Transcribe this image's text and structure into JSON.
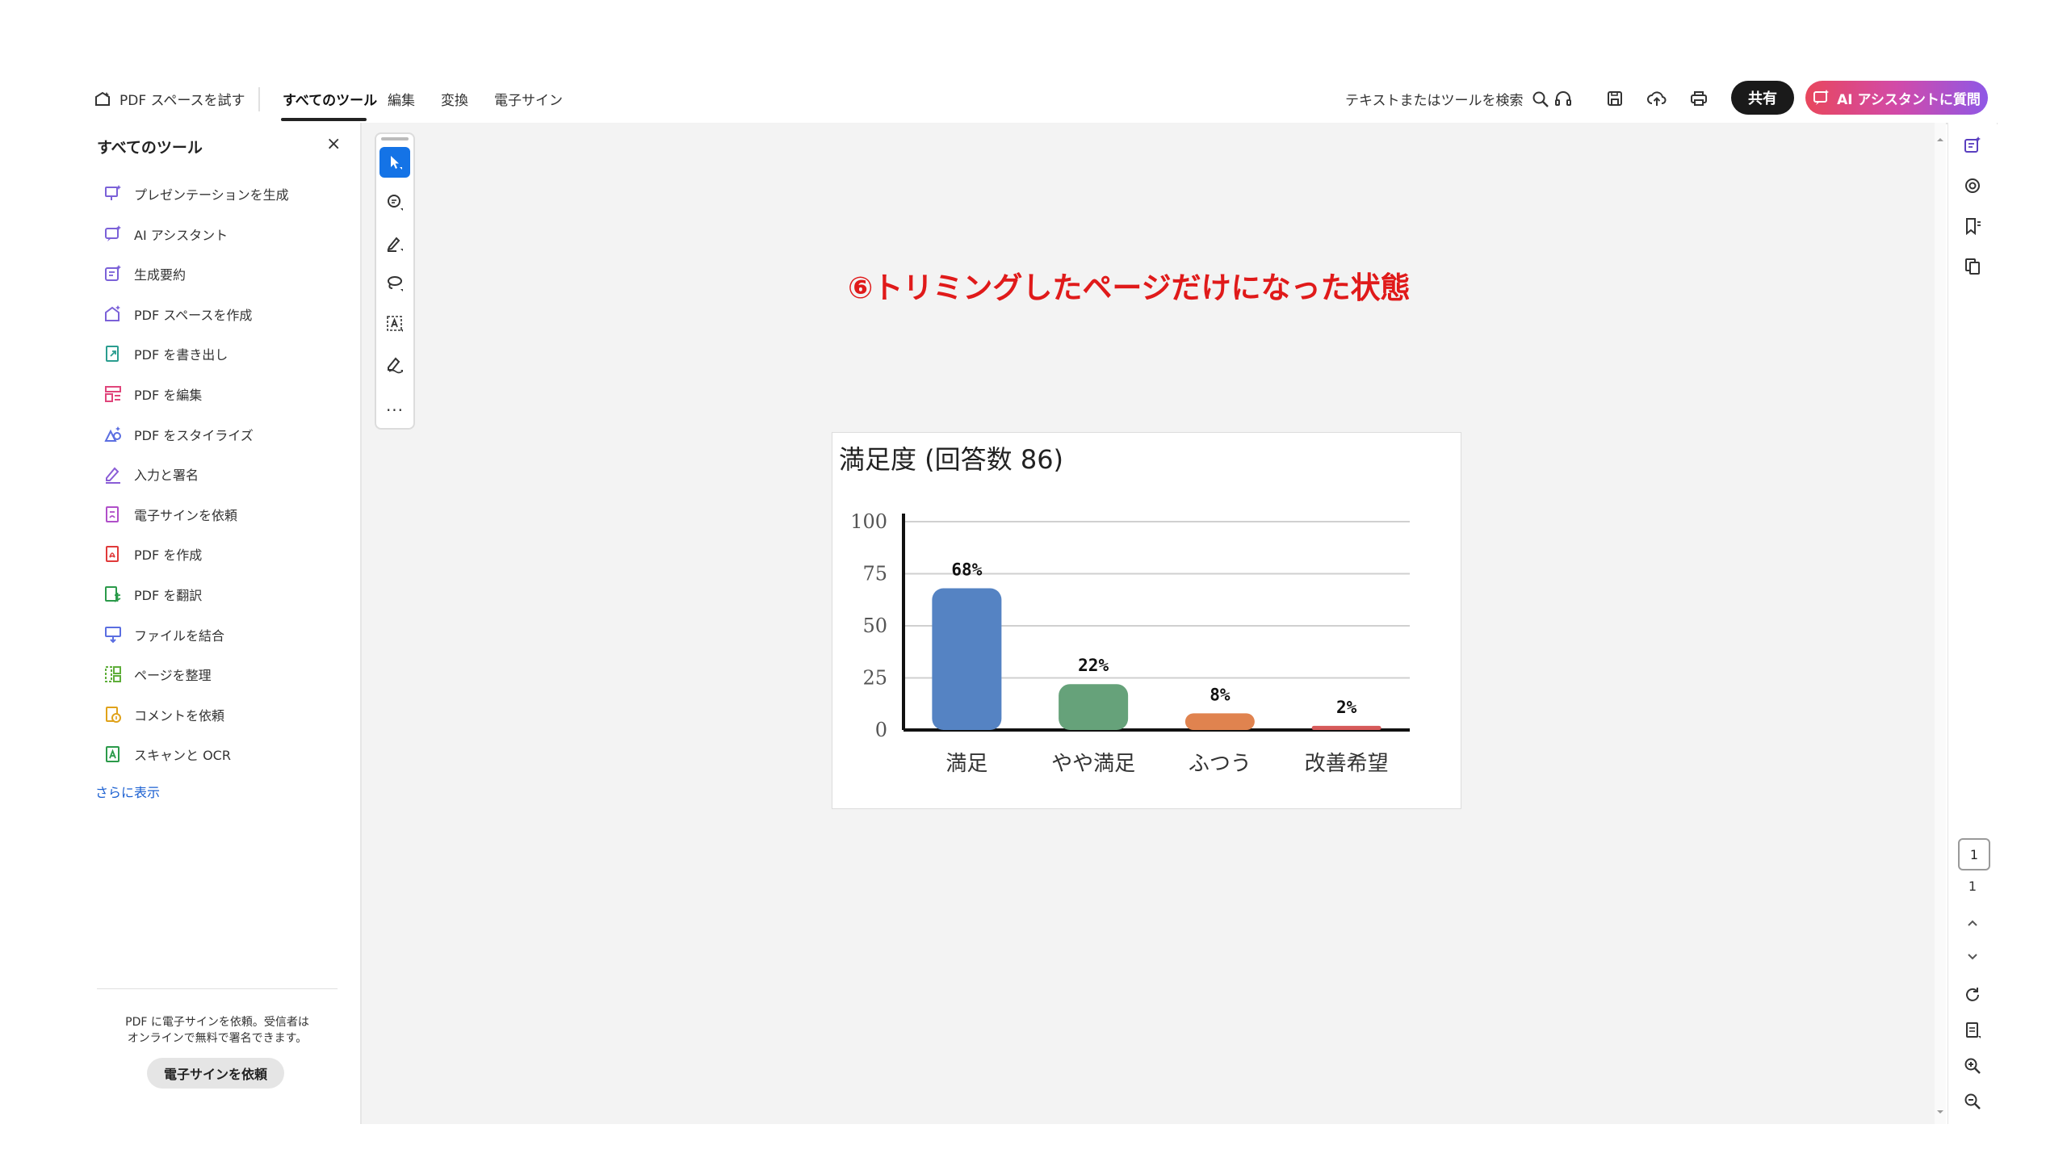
{
  "topbar": {
    "pdf_space_try": "PDF スペースを試す",
    "tabs": [
      {
        "label": "すべてのツール",
        "active": true
      },
      {
        "label": "編集",
        "active": false
      },
      {
        "label": "変換",
        "active": false
      },
      {
        "label": "電子サイン",
        "active": false
      }
    ],
    "search_label": "テキストまたはツールを検索",
    "share_label": "共有",
    "ai_button_label": "AI アシスタントに質問",
    "icons": [
      "search-icon",
      "headphones-icon",
      "save-icon",
      "cloud-upload-icon",
      "print-icon"
    ]
  },
  "sidebar": {
    "title": "すべてのツール",
    "items": [
      {
        "label": "プレゼンテーションを生成",
        "icon": "presentation-icon",
        "color": "#7b61d8"
      },
      {
        "label": "AI アシスタント",
        "icon": "ai-assistant-icon",
        "color": "#7b61d8"
      },
      {
        "label": "生成要約",
        "icon": "summary-icon",
        "color": "#7b61d8"
      },
      {
        "label": "PDF スペースを作成",
        "icon": "pdf-space-icon",
        "color": "#7b61d8"
      },
      {
        "label": "PDF を書き出し",
        "icon": "export-pdf-icon",
        "color": "#2a9d8f"
      },
      {
        "label": "PDF を編集",
        "icon": "edit-pdf-icon",
        "color": "#e0457b"
      },
      {
        "label": "PDF をスタイライズ",
        "icon": "stylize-icon",
        "color": "#5b6ee1"
      },
      {
        "label": "入力と署名",
        "icon": "fill-sign-icon",
        "color": "#8a5cd6"
      },
      {
        "label": "電子サインを依頼",
        "icon": "request-esign-icon",
        "color": "#b04fc9"
      },
      {
        "label": "PDF を作成",
        "icon": "create-pdf-icon",
        "color": "#e03a3a"
      },
      {
        "label": "PDF を翻訳",
        "icon": "translate-icon",
        "color": "#2b9a4a"
      },
      {
        "label": "ファイルを結合",
        "icon": "combine-icon",
        "color": "#5b6ee1"
      },
      {
        "label": "ページを整理",
        "icon": "organize-icon",
        "color": "#5fae3a"
      },
      {
        "label": "コメントを依頼",
        "icon": "request-comment-icon",
        "color": "#e0a21a"
      },
      {
        "label": "スキャンと OCR",
        "icon": "scan-ocr-icon",
        "color": "#2b9a4a"
      }
    ],
    "more_label": "さらに表示",
    "footer_text_line1": "PDF に電子サインを依頼。受信者は",
    "footer_text_line2": "オンラインで無料で署名できます。",
    "footer_button": "電子サインを依頼"
  },
  "toolstrip": {
    "tools": [
      "select-tool-icon",
      "comment-tool-icon",
      "highlight-tool-icon",
      "lasso-tool-icon",
      "text-select-icon",
      "draw-tool-icon"
    ],
    "more_label": "..."
  },
  "document": {
    "heading": "⑥トリミングしたページだけになった状態"
  },
  "chart_data": {
    "type": "bar",
    "title": "満足度 (回答数 86)",
    "categories": [
      "満足",
      "やや満足",
      "ふつう",
      "改善希望"
    ],
    "values": [
      68,
      22,
      8,
      2
    ],
    "data_labels": [
      "68%",
      "22%",
      "8%",
      "2%"
    ],
    "colors": [
      "#5583c3",
      "#66a27a",
      "#e0834f",
      "#d65a5a"
    ],
    "yticks": [
      0,
      25,
      50,
      75,
      100
    ],
    "ylim": [
      0,
      100
    ],
    "xlabel": "",
    "ylabel": "",
    "grid": true
  },
  "rightrail": {
    "icons": [
      "ai-summary-icon",
      "comment-panel-icon",
      "bookmark-icon",
      "copy-pages-icon"
    ],
    "page_current": "1",
    "page_total": "1",
    "nav_icons": [
      "chevron-up-icon",
      "chevron-down-icon",
      "rotate-icon",
      "page-fit-icon",
      "zoom-in-icon",
      "zoom-out-icon"
    ]
  }
}
